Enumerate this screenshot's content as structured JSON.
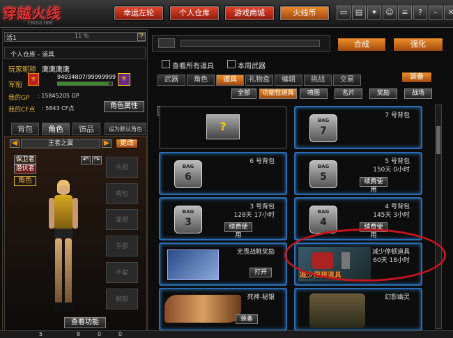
{
  "topbar": {
    "logo": "穿越火线",
    "buttons": [
      {
        "label": "幸运左轮",
        "style": "red"
      },
      {
        "label": "个人仓库",
        "style": "red"
      },
      {
        "label": "游戏商城",
        "style": "red"
      },
      {
        "label": "火线币",
        "style": "orange"
      }
    ],
    "icons": [
      "tv-icon",
      "chart-icon",
      "shield-icon",
      "group-icon",
      "list-icon",
      "question-icon",
      "minimize-icon",
      "close-icon"
    ]
  },
  "left": {
    "header_left": "活1",
    "header_mid": "11 %",
    "header_help": "?",
    "breadcrumb": "个人仓库 - 道具",
    "nickname_label": "玩家昵称",
    "nickname": "鹰鹰鹰鹰",
    "rank_label": "军衔",
    "exp": "94034807/99999999",
    "gp_label": "我的GP",
    "gp_value": ": 15845205 GP",
    "cf_label": "我的CF点",
    "cf_value": ": 5843 CF点",
    "attr_button": "角色属性",
    "tabs": [
      "背包",
      "角色",
      "饰品",
      "设为默认角色"
    ],
    "character_name": "王者之翼",
    "prev_button": "◀",
    "next_button": "▶",
    "switch_button": "更改",
    "role_tags": [
      "保卫者",
      "潜伏者"
    ],
    "role_label": "角色",
    "slots": [
      "头部",
      "背包",
      "面部",
      "手部",
      "手套",
      "脚部"
    ],
    "bottom_button": "查看功能"
  },
  "right": {
    "top_buttons": [
      "合成",
      "强化"
    ],
    "filter_all": "查看所有道具",
    "filter_week": "本周武器",
    "main_tabs": [
      "武器",
      "角色",
      "道具",
      "礼物盒",
      "编辑",
      "挑战",
      "交易"
    ],
    "main_tab_active": 2,
    "equip_button": "装备",
    "sub_tabs": [
      "全部",
      "功能性道具",
      "喷图",
      "名片",
      "奖励",
      "战场"
    ],
    "sub_tab_active": 1,
    "items": [
      {
        "name": "",
        "time": "",
        "action": "",
        "bag": "",
        "kind": "box"
      },
      {
        "name": "7 号背包",
        "time": "",
        "action": "",
        "bag": "7",
        "kind": "bag"
      },
      {
        "name": "6 号背包",
        "time": "",
        "action": "",
        "bag": "6",
        "kind": "bag"
      },
      {
        "name": "5 号背包",
        "time": "150天 0小时",
        "action": "续费使用",
        "bag": "5",
        "kind": "bag"
      },
      {
        "name": "3 号背包",
        "time": "128天 17小时",
        "action": "续费使用",
        "bag": "3",
        "kind": "bag"
      },
      {
        "name": "4 号背包",
        "time": "145天 3小时",
        "action": "续费使用",
        "bag": "4",
        "kind": "bag"
      },
      {
        "name": "无畏战靴奖励",
        "time": "",
        "action": "打开",
        "bag": "",
        "kind": "book"
      },
      {
        "name": "减少停顿道具",
        "time": "60天 18小时",
        "action": "",
        "bag": "",
        "kind": "robot",
        "overlay": "减少停顿道具"
      },
      {
        "name": "死神-秘银",
        "time": "",
        "action": "装备",
        "bag": "",
        "kind": "weapon"
      },
      {
        "name": "幻影幽灵",
        "time": "",
        "action": "",
        "bag": "",
        "kind": "soldiers"
      }
    ]
  },
  "bottombar": {
    "a": "5",
    "b": "8",
    "c": "0",
    "d": "0"
  }
}
